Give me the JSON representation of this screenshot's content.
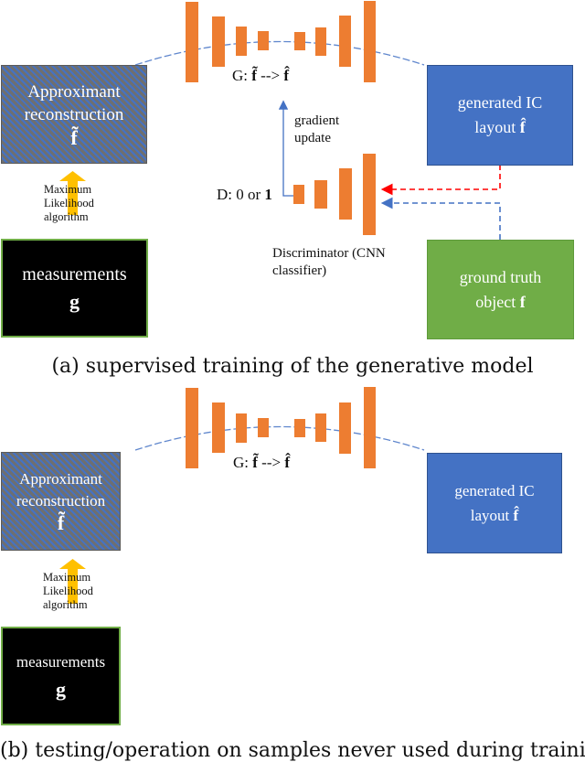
{
  "panel_a": {
    "approx_box": {
      "line1": "Approximant",
      "line2": "reconstruction",
      "symbol": "f̃"
    },
    "ml_label": {
      "line1": "Maximum",
      "line2": "Likelihood",
      "line3": "algorithm"
    },
    "measurements_box": {
      "line1": "measurements",
      "symbol": "g"
    },
    "generator_label": {
      "prefix": "G:",
      "input": "f̃",
      "arrow": "-->",
      "output": "f̂"
    },
    "generated_box": {
      "line1": "generated IC",
      "line2": "layout",
      "symbol": "f̂"
    },
    "gradient_label": {
      "line1": "gradient",
      "line2": "update"
    },
    "discriminator_output": {
      "prefix": "D:",
      "text": "0 or",
      "one": "1"
    },
    "discriminator_label": {
      "line1": "Discriminator (CNN",
      "line2": "classifier)"
    },
    "ground_truth_box": {
      "line1": "ground truth",
      "line2": "object",
      "symbol": "f"
    },
    "caption": "(a) supervised training of the generative model"
  },
  "panel_b": {
    "approx_box": {
      "line1": "Approximant",
      "line2": "reconstruction",
      "symbol": "f̃"
    },
    "ml_label": {
      "line1": "Maximum",
      "line2": "Likelihood",
      "line3": "algorithm"
    },
    "measurements_box": {
      "line1": "measurements",
      "symbol": "g"
    },
    "generator_label": {
      "prefix": "G:",
      "input": "f̃",
      "arrow": "-->",
      "output": "f̂"
    },
    "generated_box": {
      "line1": "generated IC",
      "line2": "layout",
      "symbol": "f̂"
    },
    "caption": "(b) testing/operation on samples never used during training"
  },
  "colors": {
    "layer_orange": "#ed7d31",
    "link_blue": "#4472c4",
    "fake_red": "#ff0000",
    "ml_arrow": "#ffc000",
    "ground_truth_green": "#70ad47",
    "hatch_gray": "#6f6f6f"
  }
}
